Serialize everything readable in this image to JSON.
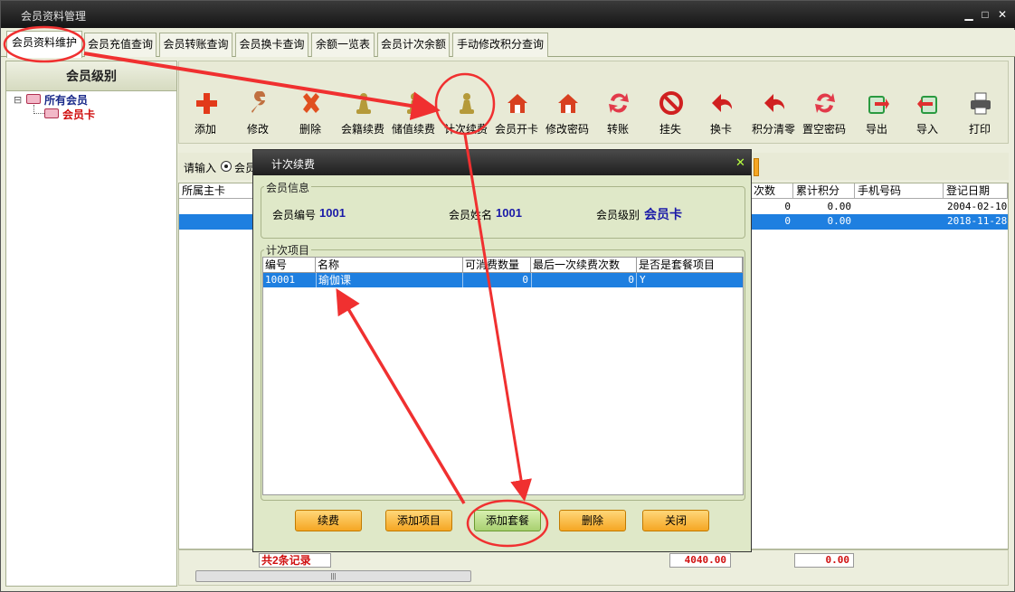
{
  "window": {
    "title": "会员资料管理",
    "min": "▁",
    "max": "□",
    "close": "✕"
  },
  "tabs": [
    "会员资料维护",
    "会员充值查询",
    "会员转账查询",
    "会员换卡查询",
    "余额一览表",
    "会员计次余额",
    "手动修改积分查询"
  ],
  "left": {
    "header": "会员级别",
    "tree_root": "所有会员",
    "tree_child": "会员卡",
    "expander": "⊟"
  },
  "toolbar": [
    {
      "label": "添加",
      "icon": "plus-icon",
      "color": "#e23a1a"
    },
    {
      "label": "修改",
      "icon": "wrench-icon",
      "color": "#c07040"
    },
    {
      "label": "删除",
      "icon": "x-icon",
      "color": "#e05020"
    },
    {
      "label": "会籍续费",
      "icon": "pawn-icon",
      "color": "#b59a3a"
    },
    {
      "label": "储值续费",
      "icon": "pawn-icon",
      "color": "#b59a3a"
    },
    {
      "label": "计次续费",
      "icon": "pawn-icon",
      "color": "#b59a3a"
    },
    {
      "label": "会员开卡",
      "icon": "house-icon",
      "color": "#d84020"
    },
    {
      "label": "修改密码",
      "icon": "house-icon",
      "color": "#d84020"
    },
    {
      "label": "转账",
      "icon": "transfer-icon",
      "color": "#e23a4a"
    },
    {
      "label": "挂失",
      "icon": "no-entry-icon",
      "color": "#d02020"
    },
    {
      "label": "换卡",
      "icon": "arrow-back-icon",
      "color": "#d02020"
    },
    {
      "label": "积分清零",
      "icon": "arrow-back-icon",
      "color": "#d02020"
    },
    {
      "label": "置空密码",
      "icon": "transfer-icon",
      "color": "#e23a4a"
    },
    {
      "label": "导出",
      "icon": "export-icon",
      "color": "#2a9a40"
    },
    {
      "label": "导入",
      "icon": "import-icon",
      "color": "#2a9a40"
    },
    {
      "label": "打印",
      "icon": "printer-icon",
      "color": "#555"
    }
  ],
  "search": {
    "prompt": "请输入",
    "radio_label": "会员"
  },
  "grid": {
    "headers": [
      "所属主卡",
      "次数",
      "累计积分",
      "手机号码",
      "登记日期"
    ],
    "rows": [
      {
        "count": "0",
        "points": "0.00",
        "phone": "",
        "date": "2004-02-10"
      },
      {
        "count": "0",
        "points": "0.00",
        "phone": "",
        "date": "2018-11-28"
      }
    ],
    "record_count": "共2条记录",
    "total_balance": "4040.00",
    "total_points": "0.00",
    "scroll_grip": "|||"
  },
  "dialog": {
    "title": "计次续费",
    "close": "✕",
    "info_group": "会员信息",
    "member_no_label": "会员编号",
    "member_no": "1001",
    "member_name_label": "会员姓名",
    "member_name": "1001",
    "member_level_label": "会员级别",
    "member_level": "会员卡",
    "items_group": "计次项目",
    "columns": [
      "编号",
      "名称",
      "可消费数量",
      "最后一次续费次数",
      "是否是套餐项目"
    ],
    "rows": [
      {
        "id": "10001",
        "name": "瑜伽课",
        "qty": "0",
        "last": "0",
        "package": "Y"
      }
    ],
    "buttons": [
      "续费",
      "添加项目",
      "添加套餐",
      "删除",
      "关闭"
    ]
  }
}
